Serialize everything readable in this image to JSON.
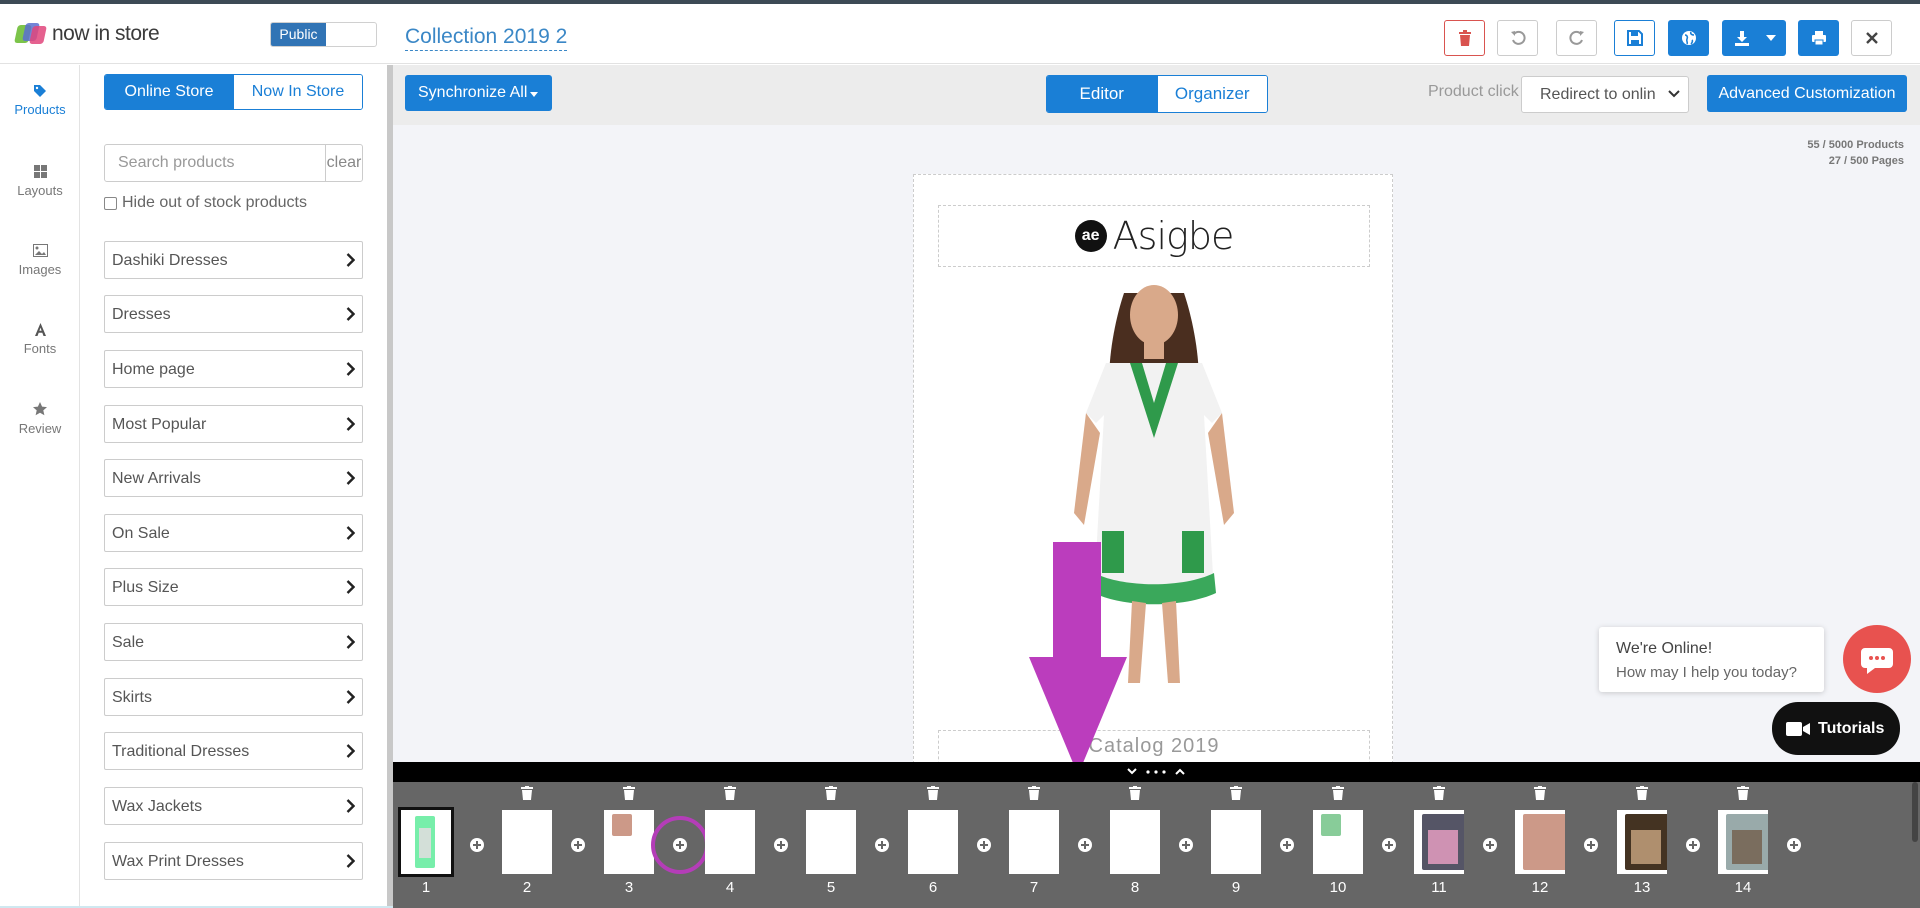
{
  "app": {
    "logo_text": "now in store",
    "visibility": "Public",
    "collection_title": "Collection 2019 2"
  },
  "toolbar": {
    "icons": [
      "trash-icon",
      "undo-icon",
      "redo-icon",
      "save-icon",
      "globe-icon",
      "download-icon",
      "print-icon",
      "close-icon"
    ],
    "colors": {
      "primary": "#1a7fd6",
      "danger": "#d9534f"
    }
  },
  "nav": {
    "items": [
      {
        "label": "Products",
        "icon": "tag-icon",
        "active": true
      },
      {
        "label": "Layouts",
        "icon": "grid-icon",
        "active": false
      },
      {
        "label": "Images",
        "icon": "image-icon",
        "active": false
      },
      {
        "label": "Fonts",
        "icon": "font-icon",
        "active": false
      },
      {
        "label": "Review",
        "icon": "star-icon",
        "active": false
      }
    ]
  },
  "products": {
    "tabs": [
      "Online Store",
      "Now In Store"
    ],
    "search_placeholder": "Search products",
    "clear_label": "clear",
    "hide_out_of_stock": "Hide out of stock products",
    "categories": [
      "Dashiki Dresses",
      "Dresses",
      "Home page",
      "Most Popular",
      "New Arrivals",
      "On Sale",
      "Plus Size",
      "Sale",
      "Skirts",
      "Traditional Dresses",
      "Wax Jackets",
      "Wax Print Dresses"
    ]
  },
  "editor": {
    "sync_label": "Synchronize All",
    "mode_tabs": [
      "Editor",
      "Organizer"
    ],
    "product_click_label": "Product click",
    "product_click_value": "Redirect to onlin",
    "advanced_label": "Advanced Customization",
    "products_count": "55 / 5000 Products",
    "pages_count": "27 / 500 Pages",
    "page": {
      "brand_mark": "ae",
      "brand_name": "Asigbe",
      "caption": "Catalog 2019"
    }
  },
  "chat": {
    "line1": "We're Online!",
    "line2": "How may I help you today?",
    "tutorials": "Tutorials",
    "chat_color": "#e8524f"
  },
  "strip": {
    "pages": [
      "1",
      "2",
      "3",
      "4",
      "5",
      "6",
      "7",
      "8",
      "9",
      "10",
      "11",
      "12",
      "13",
      "14"
    ],
    "selected": "1"
  }
}
